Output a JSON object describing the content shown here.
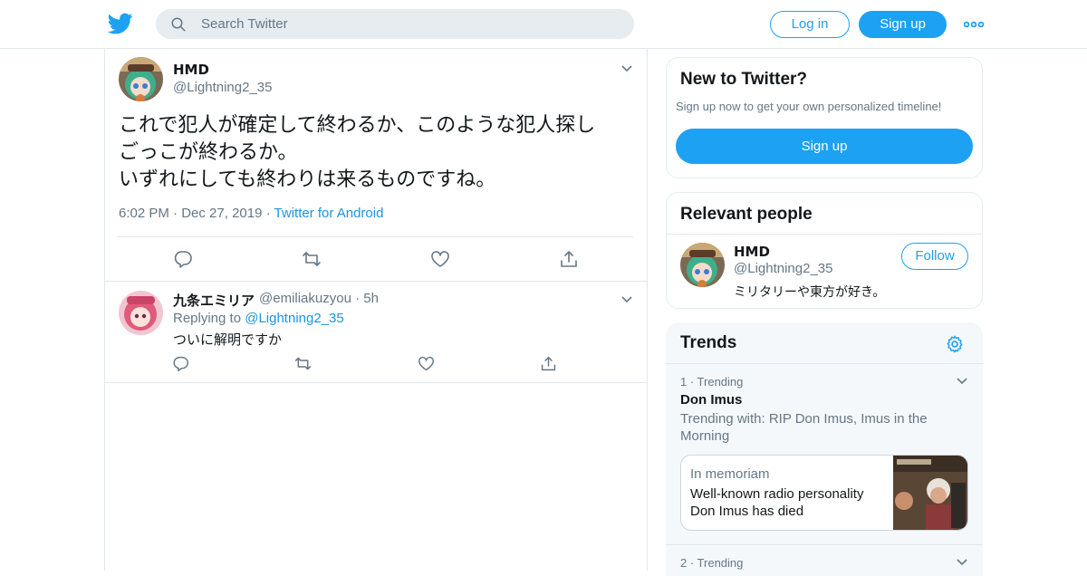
{
  "header": {
    "search_placeholder": "Search Twitter",
    "login_label": "Log in",
    "signup_label": "Sign up",
    "brand_color": "#1da1f2"
  },
  "tweet": {
    "name": "HMD",
    "handle": "@Lightning2_35",
    "text_line1": "これで犯人が確定して終わるか、このような犯人探し",
    "text_line2": "ごっこが終わるか。",
    "text_line3": "いずれにしても終わりは来るものですね。",
    "time": "6:02 PM",
    "sep": "·",
    "date": "Dec 27, 2019",
    "source": "Twitter for Android"
  },
  "reply": {
    "name": "九条エミリア",
    "handle": "@emiliakuzyou",
    "sep": "·",
    "age": "5h",
    "replying_prefix": "Replying to",
    "replying_to": "@Lightning2_35",
    "text": "ついに解明ですか"
  },
  "new_to_twitter": {
    "title": "New to Twitter?",
    "subtitle": "Sign up now to get your own personalized timeline!",
    "button": "Sign up"
  },
  "relevant_people": {
    "title": "Relevant people",
    "name": "HMD",
    "handle": "@Lightning2_35",
    "bio": "ミリタリーや東方が好き。",
    "follow": "Follow"
  },
  "trends": {
    "title": "Trends",
    "items": [
      {
        "rank": "1 · Trending",
        "name": "Don Imus",
        "with": "Trending with: RIP Don Imus, Imus in the Morning",
        "moment_kicker": "In memoriam",
        "moment_headline": "Well-known radio personality Don Imus has died"
      },
      {
        "rank": "2 · Trending"
      }
    ]
  }
}
